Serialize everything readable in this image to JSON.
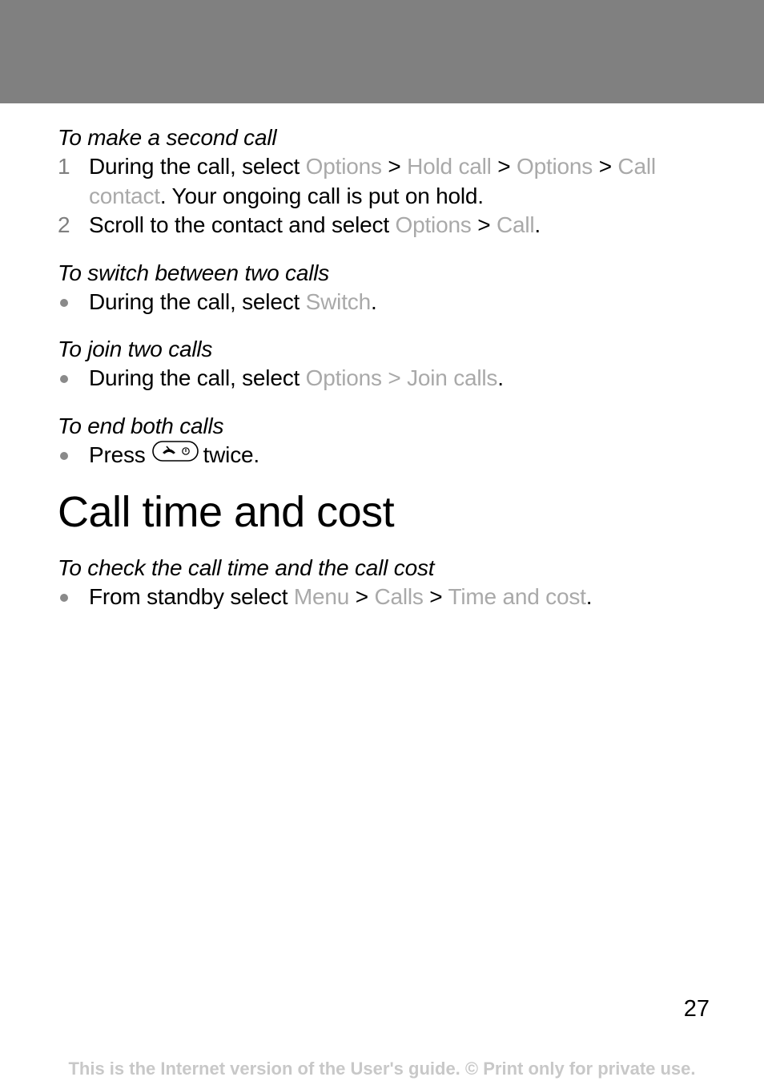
{
  "sections": [
    {
      "title": "To make a second call",
      "steps": [
        {
          "marker": "1",
          "parts": [
            "During the call, select ",
            "Options",
            " > ",
            "Hold call",
            " > ",
            "Options",
            " > ",
            "Call contact",
            ". Your ongoing call is put on hold."
          ]
        },
        {
          "marker": "2",
          "parts": [
            "Scroll to the contact and select ",
            "Options",
            " > ",
            "Call",
            "."
          ]
        }
      ]
    },
    {
      "title": "To switch between two calls",
      "steps": [
        {
          "parts": [
            "During the call, select ",
            "Switch",
            "."
          ]
        }
      ]
    },
    {
      "title": "To join two calls",
      "steps": [
        {
          "parts": [
            "During the call, select ",
            "Options > Join calls",
            "."
          ]
        }
      ]
    },
    {
      "title": "To end both calls",
      "steps": [
        {
          "parts": [
            "Press",
            "twice."
          ],
          "icon": "end-call-key-icon"
        }
      ]
    }
  ],
  "heading": "Call time and cost",
  "section_after_heading": {
    "title": "To check the call time and the call cost",
    "steps": [
      {
        "parts": [
          "From standby select ",
          "Menu",
          " > ",
          "Calls",
          " > ",
          "Time and cost",
          "."
        ]
      }
    ]
  },
  "page_number": "27",
  "footer": "This is the Internet version of the User's guide. © Print only for private use.",
  "colors": {
    "header_band": "#808080",
    "ui_term": "#a9a9a9",
    "footer": "#c8c8c8"
  }
}
